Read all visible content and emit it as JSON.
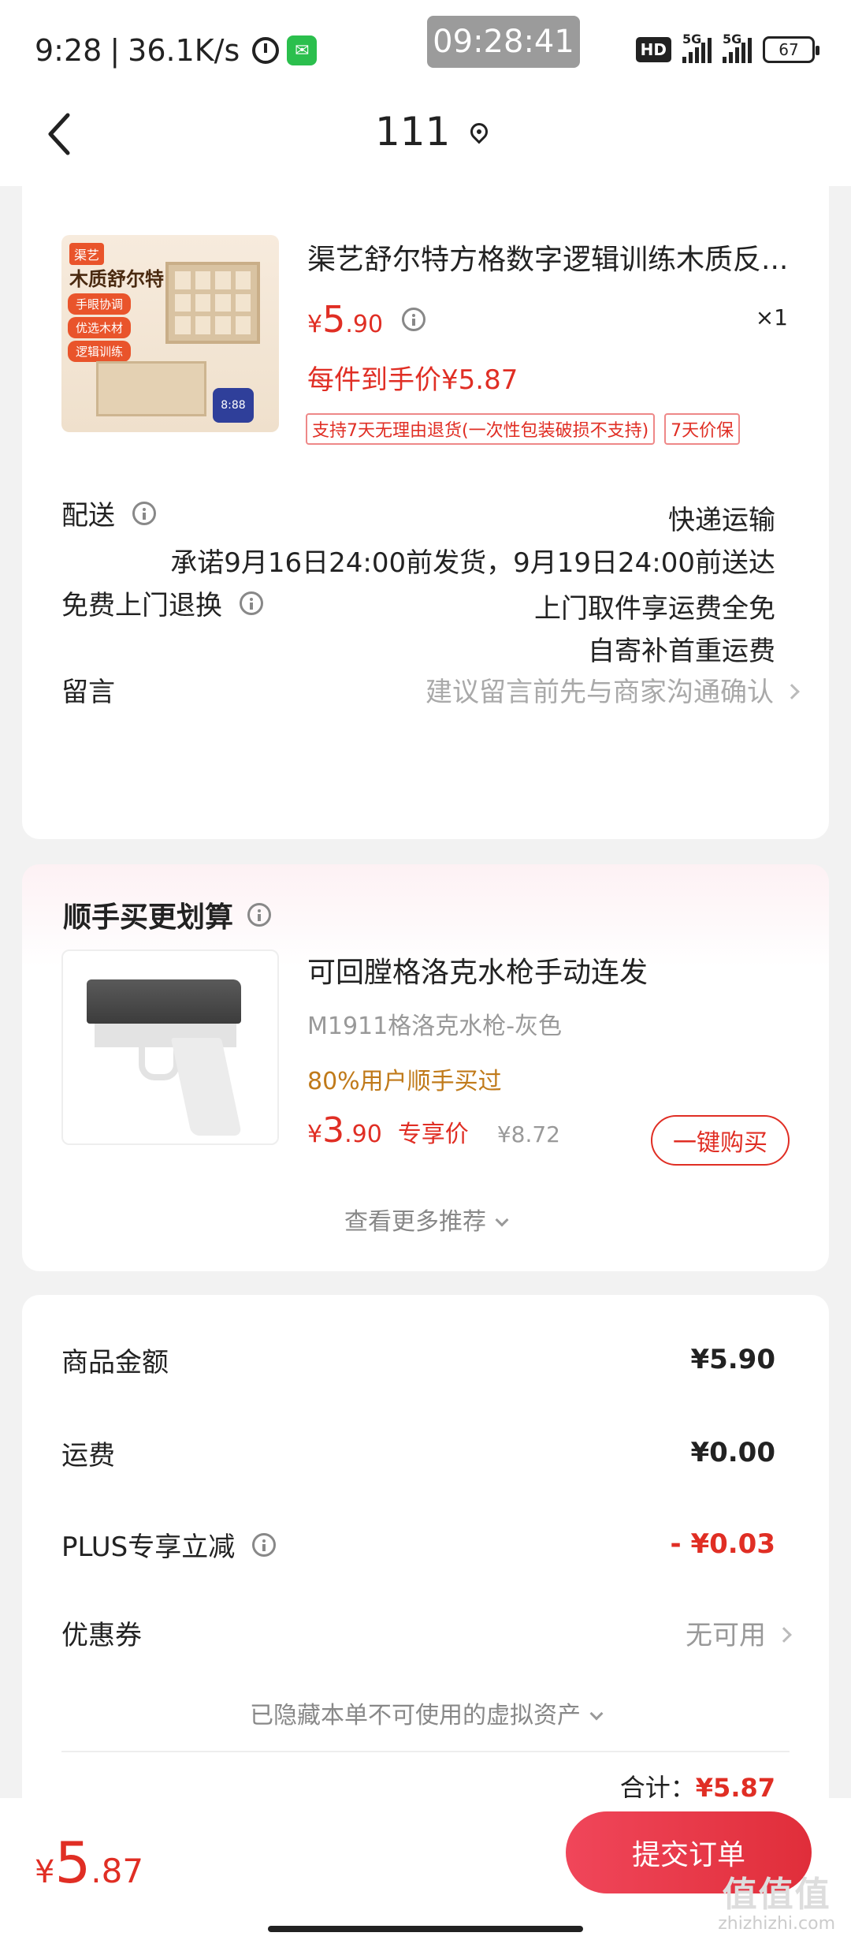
{
  "status_bar": {
    "time": "9:28",
    "net_speed": "36.1K/s",
    "clock_overlay": "09:28:41",
    "hd": "HD",
    "net1": "5G",
    "net2": "5G",
    "battery": "67"
  },
  "nav": {
    "title": "111"
  },
  "product": {
    "title": "渠艺舒尔特方格数字逻辑训练木质反...",
    "thumb_tag": "渠艺",
    "thumb_title": "木质舒尔特",
    "thumb_chips": [
      "手眼协调",
      "优选木材",
      "逻辑训练"
    ],
    "thumb_timer": "8:88",
    "price_symbol": "¥",
    "price_int": "5",
    "price_dec": ".90",
    "quantity": "×1",
    "final_price": "每件到手价¥5.87",
    "tags": [
      "支持7天无理由退货(一次性包装破损不支持)",
      "7天价保"
    ]
  },
  "delivery": {
    "label": "配送",
    "method": "快递运输",
    "promise": "承诺9月16日24:00前发货，9月19日24:00前送达"
  },
  "return": {
    "label": "免费上门退换",
    "line1": "上门取件享运费全免",
    "line2": "自寄补首重运费"
  },
  "note": {
    "label": "留言",
    "placeholder": "建议留言前先与商家沟通确认"
  },
  "recommend": {
    "heading": "顺手买更划算",
    "title": "可回膛格洛克水枪手动连发",
    "spec": "M1911格洛克水枪-灰色",
    "buyers": "80%用户顺手买过",
    "price_symbol": "¥",
    "price_int": "3",
    "price_dec": ".90",
    "exclusive": "专享价",
    "orig_price": "¥8.72",
    "buy_label": "一键购买",
    "more": "查看更多推荐"
  },
  "summary": {
    "items": [
      {
        "label": "商品金额",
        "value": "¥5.90"
      },
      {
        "label": "运费",
        "value": "¥0.00"
      },
      {
        "label": "PLUS专享立减",
        "value": "- ¥0.03"
      },
      {
        "label": "优惠券",
        "value": "无可用"
      }
    ],
    "hidden_note": "已隐藏本单不可使用的虚拟资产",
    "total_label": "合计：",
    "total_value": "¥5.87"
  },
  "bottom": {
    "price_symbol": "¥",
    "price_int": "5",
    "price_dec": ".87",
    "submit_label": "提交订单"
  },
  "watermark": {
    "big": "值值值",
    "small": "zhizhizhi.com"
  },
  "colors": {
    "accent": "#e02e24",
    "buyers": "#c07a1a",
    "page_bg": "#f2f2f2"
  }
}
